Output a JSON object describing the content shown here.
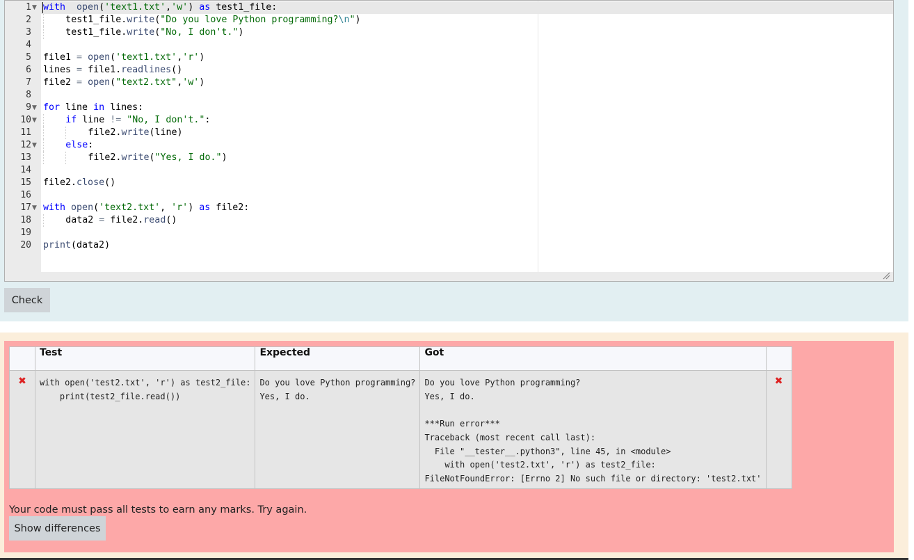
{
  "editor": {
    "lines": [
      {
        "n": "1",
        "fold": true,
        "indent": 0,
        "tokens": [
          [
            "kw",
            "with"
          ],
          [
            "",
            "  "
          ],
          [
            "fn",
            "open"
          ],
          [
            "",
            "("
          ],
          [
            "str",
            "'text1.txt'"
          ],
          [
            "",
            ","
          ],
          [
            "str",
            "'w'"
          ],
          [
            "",
            ") "
          ],
          [
            "kw",
            "as"
          ],
          [
            "",
            " test1_file:"
          ]
        ]
      },
      {
        "n": "2",
        "fold": false,
        "indent": 1,
        "tokens": [
          [
            "",
            "test1_file."
          ],
          [
            "fn",
            "write"
          ],
          [
            "",
            "("
          ],
          [
            "str",
            "\"Do you love Python programming?"
          ],
          [
            "esc",
            "\\n"
          ],
          [
            "str",
            "\""
          ],
          [
            "",
            ")"
          ]
        ]
      },
      {
        "n": "3",
        "fold": false,
        "indent": 1,
        "tokens": [
          [
            "",
            "test1_file."
          ],
          [
            "fn",
            "write"
          ],
          [
            "",
            "("
          ],
          [
            "str",
            "\"No, I don't.\""
          ],
          [
            "",
            ")"
          ]
        ]
      },
      {
        "n": "4",
        "fold": false,
        "indent": 0,
        "tokens": []
      },
      {
        "n": "5",
        "fold": false,
        "indent": 0,
        "tokens": [
          [
            "",
            "file1 "
          ],
          [
            "op",
            "="
          ],
          [
            "",
            ""
          ],
          [
            "",
            " "
          ],
          [
            "fn",
            "open"
          ],
          [
            "",
            "("
          ],
          [
            "str",
            "'text1.txt'"
          ],
          [
            "",
            ","
          ],
          [
            "str",
            "'r'"
          ],
          [
            "",
            ")"
          ]
        ]
      },
      {
        "n": "6",
        "fold": false,
        "indent": 0,
        "tokens": [
          [
            "",
            "lines "
          ],
          [
            "op",
            "="
          ],
          [
            "",
            " file1."
          ],
          [
            "fn",
            "readlines"
          ],
          [
            "",
            "()"
          ]
        ]
      },
      {
        "n": "7",
        "fold": false,
        "indent": 0,
        "tokens": [
          [
            "",
            "file2 "
          ],
          [
            "op",
            "="
          ],
          [
            "",
            " "
          ],
          [
            "fn",
            "open"
          ],
          [
            "",
            "("
          ],
          [
            "str",
            "\"text2.txt\""
          ],
          [
            "",
            ","
          ],
          [
            "str",
            "'w'"
          ],
          [
            "",
            ")"
          ]
        ]
      },
      {
        "n": "8",
        "fold": false,
        "indent": 0,
        "tokens": []
      },
      {
        "n": "9",
        "fold": true,
        "indent": 0,
        "tokens": [
          [
            "kw",
            "for"
          ],
          [
            "",
            " line "
          ],
          [
            "kw",
            "in"
          ],
          [
            "",
            " lines:"
          ]
        ]
      },
      {
        "n": "10",
        "fold": true,
        "indent": 1,
        "tokens": [
          [
            "kw",
            "if"
          ],
          [
            "",
            " line "
          ],
          [
            "op",
            "!="
          ],
          [
            "",
            " "
          ],
          [
            "str",
            "\"No, I don't.\""
          ],
          [
            "",
            ":"
          ]
        ]
      },
      {
        "n": "11",
        "fold": false,
        "indent": 2,
        "tokens": [
          [
            "",
            "file2."
          ],
          [
            "fn",
            "write"
          ],
          [
            "",
            "(line)"
          ]
        ]
      },
      {
        "n": "12",
        "fold": true,
        "indent": 1,
        "tokens": [
          [
            "kw",
            "else"
          ],
          [
            "",
            ":"
          ]
        ]
      },
      {
        "n": "13",
        "fold": false,
        "indent": 2,
        "tokens": [
          [
            "",
            "file2."
          ],
          [
            "fn",
            "write"
          ],
          [
            "",
            "("
          ],
          [
            "str",
            "\"Yes, I do.\""
          ],
          [
            "",
            ")"
          ]
        ]
      },
      {
        "n": "14",
        "fold": false,
        "indent": 0,
        "tokens": []
      },
      {
        "n": "15",
        "fold": false,
        "indent": 0,
        "tokens": [
          [
            "",
            "file2."
          ],
          [
            "fn",
            "close"
          ],
          [
            "",
            "()"
          ]
        ]
      },
      {
        "n": "16",
        "fold": false,
        "indent": 0,
        "tokens": []
      },
      {
        "n": "17",
        "fold": true,
        "indent": 0,
        "tokens": [
          [
            "kw",
            "with"
          ],
          [
            "",
            " "
          ],
          [
            "fn",
            "open"
          ],
          [
            "",
            "("
          ],
          [
            "str",
            "'text2.txt'"
          ],
          [
            "",
            ", "
          ],
          [
            "str",
            "'r'"
          ],
          [
            "",
            ") "
          ],
          [
            "kw",
            "as"
          ],
          [
            "",
            " file2:"
          ]
        ]
      },
      {
        "n": "18",
        "fold": false,
        "indent": 1,
        "tokens": [
          [
            "",
            "data2 "
          ],
          [
            "op",
            "="
          ],
          [
            "",
            " file2."
          ],
          [
            "fn",
            "read"
          ],
          [
            "",
            "()"
          ]
        ]
      },
      {
        "n": "19",
        "fold": false,
        "indent": 0,
        "tokens": []
      },
      {
        "n": "20",
        "fold": false,
        "indent": 0,
        "tokens": [
          [
            "fn",
            "print"
          ],
          [
            "",
            "(data2)"
          ]
        ]
      }
    ]
  },
  "check_button": "Check",
  "results": {
    "headers": {
      "test": "Test",
      "expected": "Expected",
      "got": "Got"
    },
    "rows": [
      {
        "test": "with open('test2.txt', 'r') as test2_file:\n    print(test2_file.read())",
        "expected": "Do you love Python programming?\nYes, I do.",
        "got_output": "Do you love Python programming?\nYes, I do.",
        "got_error": "***Run error***\nTraceback (most recent call last):\n  File \"__tester__.python3\", line 45, in <module>\n    with open('test2.txt', 'r') as test2_file:\nFileNotFoundError: [Errno 2] No such file or directory: 'test2.txt'"
      }
    ],
    "message": "Your code must pass all tests to earn any marks. Try again.",
    "show_differences_button": "Show differences"
  },
  "icons": {
    "fail": "close-icon",
    "fold": "fold-arrow-icon",
    "resize": "resize-grip-icon"
  },
  "colors": {
    "fail_bg": "#fda8a8",
    "fail_icon": "#dd2222",
    "editor_section_bg": "#e2eff2",
    "results_outer_bg": "#fbeedb"
  }
}
